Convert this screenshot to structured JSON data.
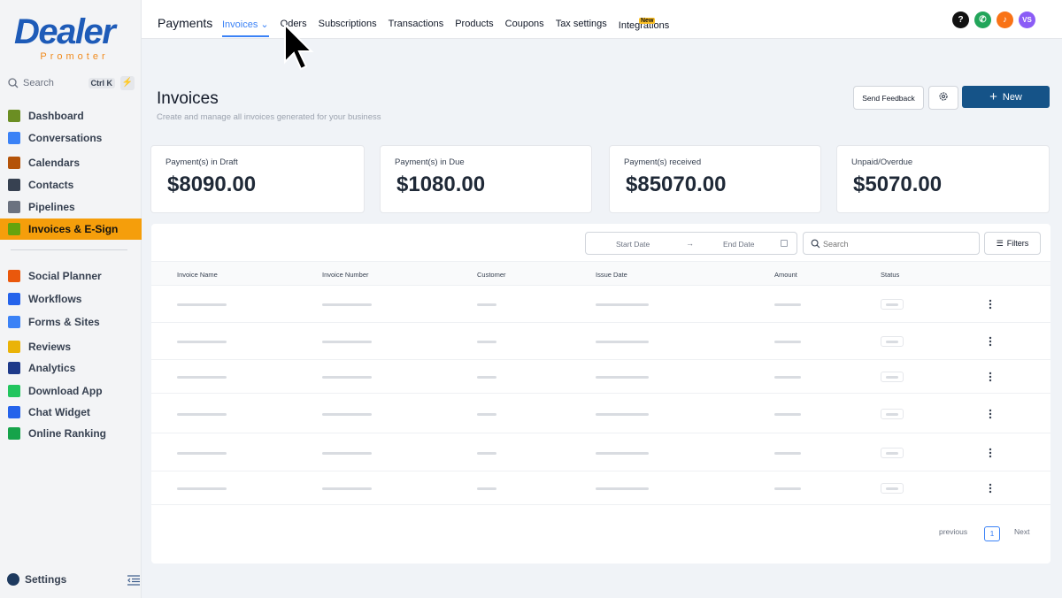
{
  "brand": {
    "name": "Dealer",
    "tagline": "Promoter"
  },
  "sidebar": {
    "search_label": "Search",
    "search_shortcut": "Ctrl K",
    "items": [
      {
        "label": "Dashboard",
        "icon": "dashboard-icon",
        "color": "#6b8e23"
      },
      {
        "label": "Conversations",
        "icon": "chat-bubbles-icon",
        "color": "#3b82f6"
      },
      {
        "label": "Calendars",
        "icon": "calendar-icon",
        "color": "#b45309"
      },
      {
        "label": "Contacts",
        "icon": "contacts-icon",
        "color": "#374151"
      },
      {
        "label": "Pipelines",
        "icon": "pipeline-icon",
        "color": "#6b7280"
      },
      {
        "label": "Invoices & E-Sign",
        "icon": "invoice-icon",
        "color": "#65a30d"
      },
      {
        "label": "Social Planner",
        "icon": "megaphone-icon",
        "color": "#ea580c"
      },
      {
        "label": "Workflows",
        "icon": "workflow-icon",
        "color": "#2563eb"
      },
      {
        "label": "Forms & Sites",
        "icon": "forms-icon",
        "color": "#3b82f6"
      },
      {
        "label": "Reviews",
        "icon": "star-icon",
        "color": "#eab308"
      },
      {
        "label": "Analytics",
        "icon": "analytics-icon",
        "color": "#1e3a8a"
      },
      {
        "label": "Download App",
        "icon": "phone-icon",
        "color": "#22c55e"
      },
      {
        "label": "Chat Widget",
        "icon": "chat-widget-icon",
        "color": "#2563eb"
      },
      {
        "label": "Online Ranking",
        "icon": "ranking-icon",
        "color": "#16a34a"
      }
    ],
    "settings_label": "Settings"
  },
  "topbar": {
    "title": "Payments",
    "tabs": [
      "Invoices",
      "Oders",
      "Subscriptions",
      "Transactions",
      "Products",
      "Coupons",
      "Tax settings",
      "Integrations"
    ],
    "new_badge": "New",
    "help_label": "?",
    "avatar_initials": "VS"
  },
  "page": {
    "title": "Invoices",
    "subtitle": "Create and manage all invoices generated for your business",
    "feedback_label": "Send Feedback",
    "new_label": "New"
  },
  "stats": [
    {
      "label": "Payment(s) in Draft",
      "value": "$8090.00"
    },
    {
      "label": "Payment(s) in Due",
      "value": "$1080.00"
    },
    {
      "label": "Payment(s) received",
      "value": "$85070.00"
    },
    {
      "label": "Unpaid/Overdue",
      "value": "$5070.00"
    }
  ],
  "table": {
    "start_date_label": "Start Date",
    "end_date_label": "End Date",
    "search_placeholder": "Search",
    "filters_label": "Filters",
    "columns": [
      "Invoice Name",
      "Invoice Number",
      "Customer",
      "Issue Date",
      "Amount",
      "Status"
    ],
    "row_count": 6,
    "pagination": {
      "previous": "previous",
      "current": "1",
      "next": "Next"
    }
  },
  "colors": {
    "accent": "#155388",
    "active_nav": "#f59e0b",
    "tab_active": "#3b82f6",
    "brand_blue": "#1e5bb8",
    "brand_orange": "#f08a1c"
  }
}
